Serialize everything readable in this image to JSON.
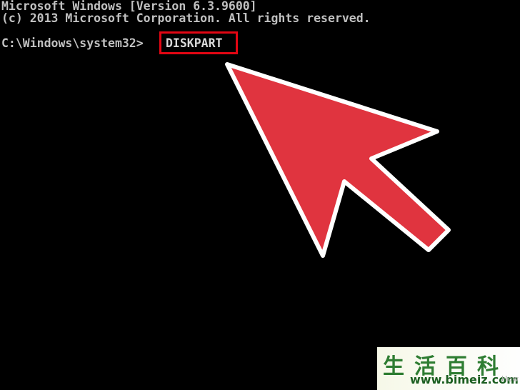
{
  "console": {
    "line1": "Microsoft Windows [Version 6.3.9600]",
    "line2": "(c) 2013 Microsoft Corporation. All rights reserved.",
    "prompt": "C:\\Windows\\system32>",
    "command": "DISKPART"
  },
  "highlight": {
    "color": "#e30613"
  },
  "arrow": {
    "fill": "#e0343f",
    "stroke": "#ffffff",
    "icon": "pointer-arrow-icon"
  },
  "watermark": {
    "title": "生活百科",
    "url": "www.bimeiz.com",
    "extra": "How"
  }
}
